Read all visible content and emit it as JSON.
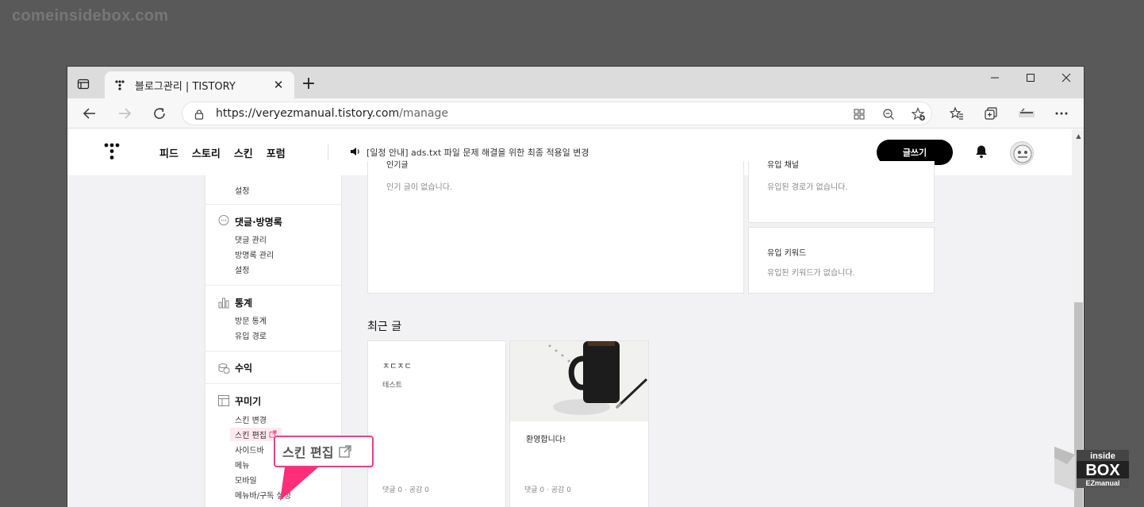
{
  "watermark": "comeinsidebox.com",
  "browser": {
    "tab_title": "블로그관리 | TISTORY",
    "tab_close": "✕",
    "new_tab": "+",
    "url_host": "https://veryezmanual.tistory.com",
    "url_path": "/manage"
  },
  "header": {
    "nav": [
      "피드",
      "스토리",
      "스킨",
      "포럼"
    ],
    "notice": "[일정 안내] ads.txt 파일 문제 해결을 위한 최종 적용일 변경",
    "write_button": "글쓰기"
  },
  "sidebar": {
    "partial_item": "설정",
    "comments": {
      "title": "댓글·방명록",
      "items": [
        "댓글 관리",
        "방명록 관리",
        "설정"
      ]
    },
    "stats": {
      "title": "통계",
      "items": [
        "방문 통계",
        "유입 경로"
      ]
    },
    "revenue": {
      "title": "수익"
    },
    "decorate": {
      "title": "꾸미기",
      "items": [
        "스킨 변경",
        "스킨 편집",
        "사이드바",
        "메뉴",
        "모바일",
        "메뉴바/구독 설정"
      ]
    }
  },
  "cards": {
    "popular": {
      "title": "인기글",
      "empty": "인기 글이 없습니다."
    },
    "channel": {
      "title": "유입 채널",
      "empty": "유입된 경로가 없습니다."
    },
    "keyword": {
      "title": "유입 키워드",
      "empty": "유입된 키워드가 없습니다."
    }
  },
  "recent": {
    "title": "최근 글",
    "posts": [
      {
        "title": "ㅈㄷㅈㄷ",
        "body": "테스트",
        "meta": "댓글 0 · 공감 0"
      },
      {
        "title": "환영합니다!",
        "meta": "댓글 0 · 공감 0"
      }
    ]
  },
  "callout": {
    "text": "스킨 편집"
  },
  "badge": {
    "line1": "inside",
    "line2": "BOX",
    "line3": "EZmanual"
  },
  "colors": {
    "accent": "#e83e8c",
    "active_bg": "#fde9ef",
    "write_button": "#000000"
  }
}
